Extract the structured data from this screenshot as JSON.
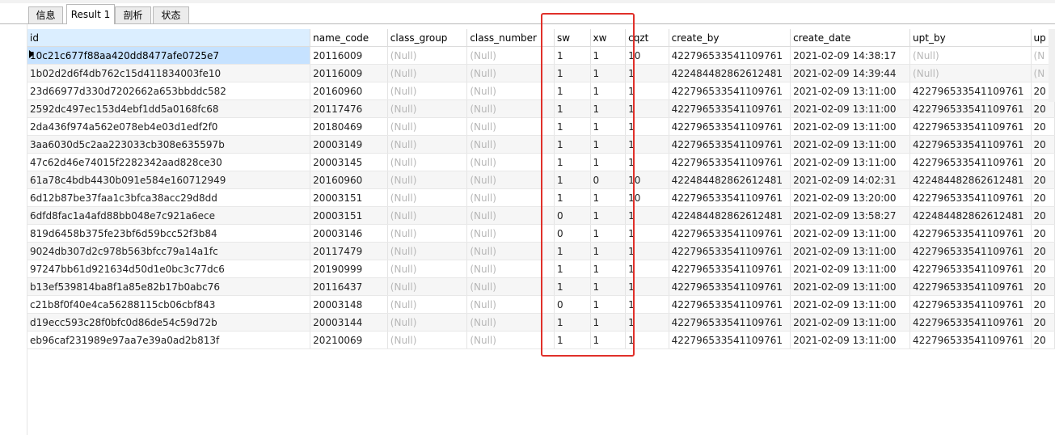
{
  "tabs": [
    {
      "label": "信息"
    },
    {
      "label": "Result 1"
    },
    {
      "label": "剖析"
    },
    {
      "label": "状态"
    }
  ],
  "table": {
    "columns": [
      "id",
      "name_code",
      "class_group",
      "class_number",
      "sw",
      "xw",
      "cqzt",
      "create_by",
      "create_date",
      "upt_by",
      "up"
    ],
    "rows": [
      [
        "10c21c677f88aa420dd8477afe0725e7",
        "20116009",
        "(Null)",
        "(Null)",
        "1",
        "1",
        "10",
        "422796533541109761",
        "2021-02-09 14:38:17",
        "(Null)",
        "(N"
      ],
      [
        "1b02d2d6f4db762c15d411834003fe10",
        "20116009",
        "(Null)",
        "(Null)",
        "1",
        "1",
        "1",
        "422484482862612481",
        "2021-02-09 14:39:44",
        "(Null)",
        "(N"
      ],
      [
        "23d66977d330d7202662a653bbddc582",
        "20160960",
        "(Null)",
        "(Null)",
        "1",
        "1",
        "1",
        "422796533541109761",
        "2021-02-09 13:11:00",
        "422796533541109761",
        "20"
      ],
      [
        "2592dc497ec153d4ebf1dd5a0168fc68",
        "20117476",
        "(Null)",
        "(Null)",
        "1",
        "1",
        "1",
        "422796533541109761",
        "2021-02-09 13:11:00",
        "422796533541109761",
        "20"
      ],
      [
        "2da436f974a562e078eb4e03d1edf2f0",
        "20180469",
        "(Null)",
        "(Null)",
        "1",
        "1",
        "1",
        "422796533541109761",
        "2021-02-09 13:11:00",
        "422796533541109761",
        "20"
      ],
      [
        "3aa6030d5c2aa223033cb308e635597b",
        "20003149",
        "(Null)",
        "(Null)",
        "1",
        "1",
        "1",
        "422796533541109761",
        "2021-02-09 13:11:00",
        "422796533541109761",
        "20"
      ],
      [
        "47c62d46e74015f2282342aad828ce30",
        "20003145",
        "(Null)",
        "(Null)",
        "1",
        "1",
        "1",
        "422796533541109761",
        "2021-02-09 13:11:00",
        "422796533541109761",
        "20"
      ],
      [
        "61a78c4bdb4430b091e584e160712949",
        "20160960",
        "(Null)",
        "(Null)",
        "1",
        "0",
        "10",
        "422484482862612481",
        "2021-02-09 14:02:31",
        "422484482862612481",
        "20"
      ],
      [
        "6d12b87be37faa1c3bfca38acc29d8dd",
        "20003151",
        "(Null)",
        "(Null)",
        "1",
        "1",
        "10",
        "422796533541109761",
        "2021-02-09 13:20:00",
        "422796533541109761",
        "20"
      ],
      [
        "6dfd8fac1a4afd88bb048e7c921a6ece",
        "20003151",
        "(Null)",
        "(Null)",
        "0",
        "1",
        "1",
        "422484482862612481",
        "2021-02-09 13:58:27",
        "422484482862612481",
        "20"
      ],
      [
        "819d6458b375fe23bf6d59bcc52f3b84",
        "20003146",
        "(Null)",
        "(Null)",
        "0",
        "1",
        "1",
        "422796533541109761",
        "2021-02-09 13:11:00",
        "422796533541109761",
        "20"
      ],
      [
        "9024db307d2c978b563bfcc79a14a1fc",
        "20117479",
        "(Null)",
        "(Null)",
        "1",
        "1",
        "1",
        "422796533541109761",
        "2021-02-09 13:11:00",
        "422796533541109761",
        "20"
      ],
      [
        "97247bb61d921634d50d1e0bc3c77dc6",
        "20190999",
        "(Null)",
        "(Null)",
        "1",
        "1",
        "1",
        "422796533541109761",
        "2021-02-09 13:11:00",
        "422796533541109761",
        "20"
      ],
      [
        "b13ef539814ba8f1a85e82b17b0abc76",
        "20116437",
        "(Null)",
        "(Null)",
        "1",
        "1",
        "1",
        "422796533541109761",
        "2021-02-09 13:11:00",
        "422796533541109761",
        "20"
      ],
      [
        "c21b8f0f40e4ca56288115cb06cbf843",
        "20003148",
        "(Null)",
        "(Null)",
        "0",
        "1",
        "1",
        "422796533541109761",
        "2021-02-09 13:11:00",
        "422796533541109761",
        "20"
      ],
      [
        "d19ecc593c28f0bfc0d86de54c59d72b",
        "20003144",
        "(Null)",
        "(Null)",
        "1",
        "1",
        "1",
        "422796533541109761",
        "2021-02-09 13:11:00",
        "422796533541109761",
        "20"
      ],
      [
        "eb96caf231989e97aa7e39a0ad2b813f",
        "20210069",
        "(Null)",
        "(Null)",
        "1",
        "1",
        "1",
        "422796533541109761",
        "2021-02-09 13:11:00",
        "422796533541109761",
        "20"
      ]
    ]
  },
  "colors": {
    "selected_cell": "#c6e2ff",
    "null_text": "#b7b7b7",
    "highlight_box": "#e0302a"
  }
}
